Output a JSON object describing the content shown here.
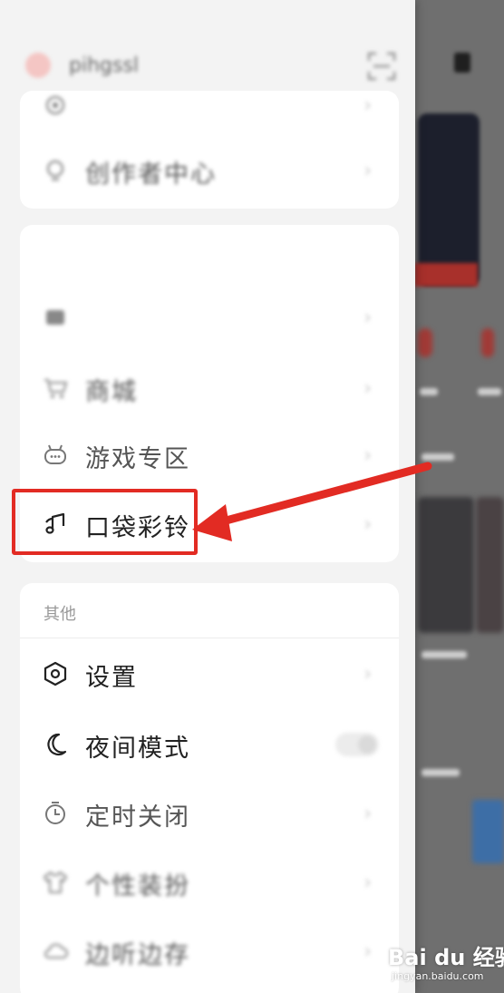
{
  "status_bar": {
    "left_text": "",
    "right_text": ""
  },
  "profile": {
    "username": "pihgssl",
    "scan_icon": "scan-icon"
  },
  "card1": {
    "items": [
      {
        "label": "",
        "icon": "gear-icon"
      },
      {
        "label": "创作者中心",
        "icon": "lightbulb-icon"
      }
    ]
  },
  "card2": {
    "title": "",
    "items": [
      {
        "label": "",
        "icon": "cloud-icon"
      },
      {
        "label": "商城",
        "icon": "cart-icon"
      },
      {
        "label": "游戏专区",
        "icon": "gamepad-icon"
      },
      {
        "label": "口袋彩铃",
        "icon": "music-note-icon"
      }
    ]
  },
  "card3": {
    "title": "其他",
    "items": [
      {
        "label": "设置",
        "icon": "hexagon-settings-icon"
      },
      {
        "label": "夜间模式",
        "icon": "moon-icon"
      },
      {
        "label": "定时关闭",
        "icon": "timer-icon"
      },
      {
        "label": "个性装扮",
        "icon": "shirt-icon"
      },
      {
        "label": "边听边存",
        "icon": "cloud-save-icon",
        "value": ""
      }
    ]
  },
  "watermark": {
    "brand": "Bai du 经验",
    "url": "jingyan.baidu.com"
  },
  "colors": {
    "highlight": "#e22b23",
    "drawer_bg": "#f3f3f3",
    "card_bg": "#ffffff",
    "backdrop": "#6f6f6f"
  }
}
